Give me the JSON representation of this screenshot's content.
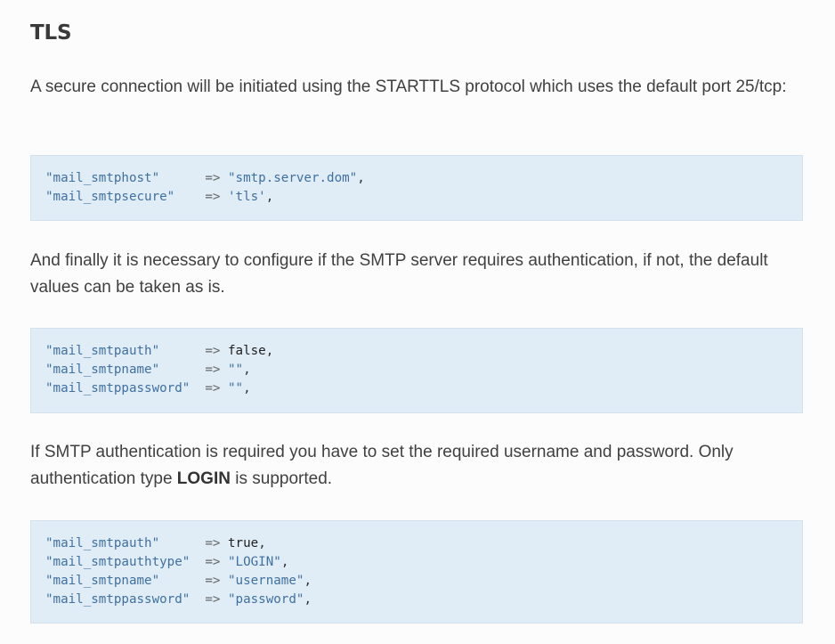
{
  "heading": "TLS",
  "paragraphs": {
    "p1": "A secure connection will be initiated using the STARTTLS protocol which uses the default port 25/tcp:",
    "p2": "And finally it is necessary to configure if the SMTP server requires authentication, if not, the default values can be taken as is.",
    "p3_before": "If SMTP authentication is required you have to set the required username and password. Only authentication type ",
    "p3_bold": "LOGIN",
    "p3_after": " is supported."
  },
  "code_blocks": [
    {
      "lines": [
        {
          "key": "\"mail_smtphost\"",
          "pad": "     ",
          "op": "=>",
          "value": "\"smtp.server.dom\"",
          "trail": ","
        },
        {
          "key": "\"mail_smtpsecure\"",
          "pad": "   ",
          "op": "=>",
          "value": "'tls'",
          "trail": ","
        }
      ]
    },
    {
      "lines": [
        {
          "key": "\"mail_smtpauth\"",
          "pad": "     ",
          "op": "=>",
          "value": "false",
          "trail": ","
        },
        {
          "key": "\"mail_smtpname\"",
          "pad": "     ",
          "op": "=>",
          "value": "\"\"",
          "trail": ","
        },
        {
          "key": "\"mail_smtppassword\"",
          "pad": " ",
          "op": "=>",
          "value": "\"\"",
          "trail": ","
        }
      ]
    },
    {
      "lines": [
        {
          "key": "\"mail_smtpauth\"",
          "pad": "     ",
          "op": "=>",
          "value": "true",
          "trail": ","
        },
        {
          "key": "\"mail_smtpauthtype\"",
          "pad": " ",
          "op": "=>",
          "value": "\"LOGIN\"",
          "trail": ","
        },
        {
          "key": "\"mail_smtpname\"",
          "pad": "     ",
          "op": "=>",
          "value": "\"username\"",
          "trail": ","
        },
        {
          "key": "\"mail_smtppassword\"",
          "pad": " ",
          "op": "=>",
          "value": "\"password\"",
          "trail": ","
        }
      ]
    }
  ]
}
